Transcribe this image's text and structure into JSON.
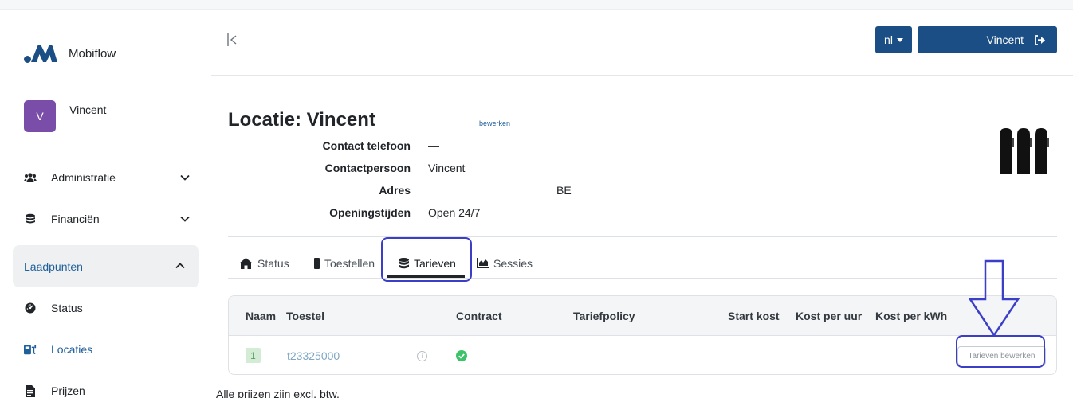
{
  "app": {
    "brand_name": "Mobiflow",
    "brand_color": "#1a4e84"
  },
  "user": {
    "avatar_letter": "V",
    "name": "Vincent",
    "avatar_color": "#7a4ea8"
  },
  "sidebar": {
    "items": [
      {
        "label": "Administratie",
        "icon": "users-icon"
      },
      {
        "label": "Financiën",
        "icon": "coins-icon"
      },
      {
        "label": "Laadpunten",
        "icon": "",
        "expanded": true
      },
      {
        "label": "Status",
        "icon": "gauge-icon"
      },
      {
        "label": "Locaties",
        "icon": "location-charger-icon"
      },
      {
        "label": "Prijzen",
        "icon": "document-icon"
      }
    ]
  },
  "header": {
    "lang_label": "nl",
    "user_button_label": "Vincent"
  },
  "location": {
    "title": "Locatie: Vincent",
    "edit_label": "bewerken",
    "fields": [
      {
        "key": "Contact telefoon",
        "value": "—"
      },
      {
        "key": "Contactpersoon",
        "value": "Vincent"
      },
      {
        "key": "Adres",
        "value": "BE"
      },
      {
        "key": "Openingstijden",
        "value": "Open 24/7"
      }
    ]
  },
  "tabs": [
    {
      "label": "Status",
      "icon": "home-icon"
    },
    {
      "label": "Toestellen",
      "icon": "device-icon"
    },
    {
      "label": "Tarieven",
      "icon": "database-icon",
      "active": true
    },
    {
      "label": "Sessies",
      "icon": "area-chart-icon"
    }
  ],
  "table": {
    "columns": [
      "Naam",
      "Toestel",
      "Contract",
      "Tariefpolicy",
      "Start kost",
      "Kost per uur",
      "Kost per kWh"
    ],
    "rows": [
      {
        "naam": "1",
        "toestel": "t23325000",
        "contract_status": "ok"
      }
    ],
    "edit_button_label": "Tarieven bewerken"
  },
  "footnote": "Alle prijzen zijn excl. btw."
}
